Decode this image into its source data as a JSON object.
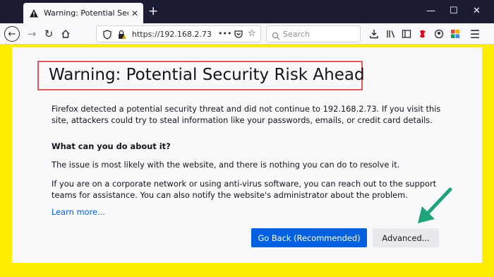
{
  "browser": {
    "tab_title": "Warning: Potential Security Ris",
    "tab_icon": "warning-triangle-icon",
    "new_tab": "+",
    "url": "https://192.168.2.73",
    "url_menu": "•••",
    "search_placeholder": "Search"
  },
  "page": {
    "title": "Warning: Potential Security Risk Ahead",
    "paragraph_detected": "Firefox detected a potential security threat and did not continue to 192.168.2.73. If you visit this site, attackers could try to steal information like your passwords, emails, or credit card details.",
    "heading_what": "What can you do about it?",
    "paragraph_issue": "The issue is most likely with the website, and there is nothing you can do to resolve it.",
    "paragraph_corporate": "If you are on a corporate network or using anti-virus software, you can reach out to the support teams for assistance. You can also notify the website's administrator about the problem.",
    "learn_more": "Learn more...",
    "go_back_label": "Go Back (Recommended)",
    "advanced_label": "Advanced..."
  },
  "colors": {
    "titlebar": "#1c1b34",
    "highlight_frame": "#ffee00",
    "title_box_border": "#e05a5a",
    "primary_button": "#0061e0",
    "arrow": "#1fa37a"
  }
}
